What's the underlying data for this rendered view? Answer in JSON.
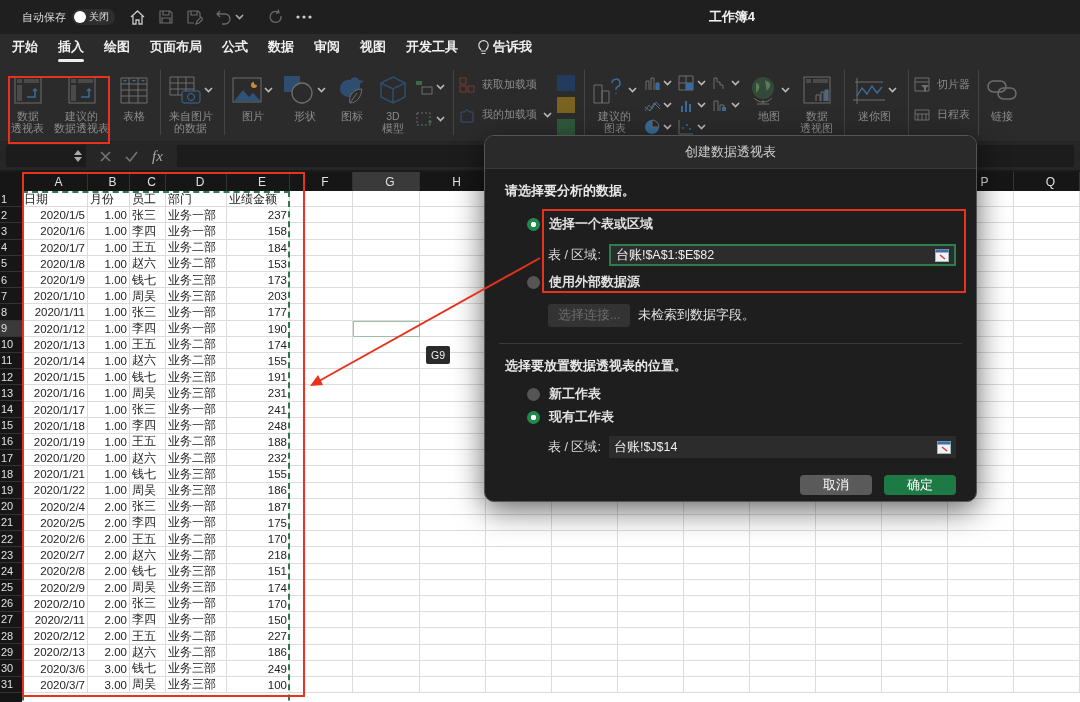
{
  "title_bar": {
    "autosave_label": "自动保存",
    "autosave_toggle": {
      "label": "关闭",
      "on": false
    },
    "title": "工作簿4"
  },
  "tabs": [
    {
      "label": "开始",
      "selected": false,
      "kind": "tab"
    },
    {
      "label": "插入",
      "selected": true,
      "kind": "tab"
    },
    {
      "label": "绘图",
      "selected": false,
      "kind": "tab"
    },
    {
      "label": "页面布局",
      "selected": false,
      "kind": "tab"
    },
    {
      "label": "公式",
      "selected": false,
      "kind": "tab"
    },
    {
      "label": "数据",
      "selected": false,
      "kind": "tab"
    },
    {
      "label": "审阅",
      "selected": false,
      "kind": "tab"
    },
    {
      "label": "视图",
      "selected": false,
      "kind": "tab"
    },
    {
      "label": "开发工具",
      "selected": false,
      "kind": "tab"
    },
    {
      "label": "告诉我",
      "selected": false,
      "kind": "tell"
    }
  ],
  "ribbon": {
    "disabled": true,
    "groups": [
      {
        "items": [
          {
            "kind": "large",
            "lines": [
              "数据",
              "透视表"
            ]
          },
          {
            "kind": "large",
            "lines": [
              "建议的",
              "数据透视表"
            ]
          },
          {
            "kind": "large",
            "lines": [
              "表格"
            ]
          }
        ]
      },
      {
        "items": [
          {
            "kind": "large",
            "lines": [
              "来自图片",
              "的数据"
            ],
            "menu": true
          }
        ]
      },
      {
        "items": [
          {
            "kind": "large",
            "lines": [
              "图片"
            ],
            "menu": true
          },
          {
            "kind": "large",
            "lines": [
              "形状"
            ],
            "menu": true
          },
          {
            "kind": "large",
            "lines": [
              "图标"
            ]
          },
          {
            "kind": "large",
            "lines": [
              "3D",
              "模型"
            ]
          },
          {
            "kind": "icons"
          }
        ]
      },
      {
        "items": [
          {
            "kind": "small_stack",
            "items": [
              {
                "label": "获取加载项",
                "menu": false
              },
              {
                "label": "我的加载项",
                "menu": true
              }
            ]
          },
          {
            "kind": "icons"
          }
        ]
      },
      {
        "items": [
          {
            "kind": "large",
            "lines": [
              "建议的",
              "图表"
            ],
            "menu": true
          },
          {
            "kind": "icons"
          },
          {
            "kind": "large",
            "lines": [
              "地图"
            ],
            "menu": true
          },
          {
            "kind": "large",
            "lines": [
              "数据",
              "透视图"
            ]
          }
        ]
      },
      {
        "items": [
          {
            "kind": "large",
            "lines": [
              "迷你图"
            ],
            "menu": true
          }
        ]
      },
      {
        "items": [
          {
            "kind": "small_stack",
            "items": [
              {
                "label": "切片器",
                "menu": false
              },
              {
                "label": "日程表",
                "menu": false
              }
            ]
          }
        ]
      },
      {
        "items": [
          {
            "kind": "large",
            "lines": [
              "链接"
            ]
          }
        ]
      }
    ]
  },
  "formula_bar": {
    "function_label": "fx"
  },
  "spreadsheet": {
    "copy_marquee": true,
    "columns": [
      {
        "label": "A",
        "selected": false
      },
      {
        "label": "B",
        "selected": false
      },
      {
        "label": "C",
        "selected": false
      },
      {
        "label": "D",
        "selected": false
      },
      {
        "label": "E",
        "selected": false
      },
      {
        "label": "F",
        "selected": false
      },
      {
        "label": "G",
        "selected": true
      },
      {
        "label": "H",
        "selected": false
      },
      {
        "label": "P",
        "selected": false
      },
      {
        "label": "Q",
        "selected": false
      }
    ],
    "rows": [
      {
        "number": "1",
        "selected": false,
        "cells": [
          "日期",
          "月份",
          "员工",
          "部门",
          "业绩金额"
        ]
      },
      {
        "number": "2",
        "selected": false,
        "cells": [
          "2020/1/5",
          "1.00",
          "张三",
          "业务一部",
          "237"
        ]
      },
      {
        "number": "3",
        "selected": false,
        "cells": [
          "2020/1/6",
          "1.00",
          "李四",
          "业务一部",
          "158"
        ]
      },
      {
        "number": "4",
        "selected": false,
        "cells": [
          "2020/1/7",
          "1.00",
          "王五",
          "业务二部",
          "184"
        ]
      },
      {
        "number": "5",
        "selected": false,
        "cells": [
          "2020/1/8",
          "1.00",
          "赵六",
          "业务二部",
          "153"
        ]
      },
      {
        "number": "6",
        "selected": false,
        "cells": [
          "2020/1/9",
          "1.00",
          "钱七",
          "业务三部",
          "173"
        ]
      },
      {
        "number": "7",
        "selected": false,
        "cells": [
          "2020/1/10",
          "1.00",
          "周吴",
          "业务三部",
          "203"
        ]
      },
      {
        "number": "8",
        "selected": false,
        "cells": [
          "2020/1/11",
          "1.00",
          "张三",
          "业务一部",
          "177"
        ]
      },
      {
        "number": "9",
        "selected": true,
        "cells": [
          "2020/1/12",
          "1.00",
          "李四",
          "业务一部",
          "190"
        ]
      },
      {
        "number": "10",
        "selected": false,
        "cells": [
          "2020/1/13",
          "1.00",
          "王五",
          "业务二部",
          "174"
        ]
      },
      {
        "number": "11",
        "selected": false,
        "cells": [
          "2020/1/14",
          "1.00",
          "赵六",
          "业务二部",
          "155"
        ]
      },
      {
        "number": "12",
        "selected": false,
        "cells": [
          "2020/1/15",
          "1.00",
          "钱七",
          "业务三部",
          "191"
        ]
      },
      {
        "number": "13",
        "selected": false,
        "cells": [
          "2020/1/16",
          "1.00",
          "周吴",
          "业务三部",
          "231"
        ]
      },
      {
        "number": "14",
        "selected": false,
        "cells": [
          "2020/1/17",
          "1.00",
          "张三",
          "业务一部",
          "241"
        ]
      },
      {
        "number": "15",
        "selected": false,
        "cells": [
          "2020/1/18",
          "1.00",
          "李四",
          "业务一部",
          "248"
        ]
      },
      {
        "number": "16",
        "selected": false,
        "cells": [
          "2020/1/19",
          "1.00",
          "王五",
          "业务二部",
          "188"
        ]
      },
      {
        "number": "17",
        "selected": false,
        "cells": [
          "2020/1/20",
          "1.00",
          "赵六",
          "业务二部",
          "232"
        ]
      },
      {
        "number": "18",
        "selected": false,
        "cells": [
          "2020/1/21",
          "1.00",
          "钱七",
          "业务三部",
          "155"
        ]
      },
      {
        "number": "19",
        "selected": false,
        "cells": [
          "2020/1/22",
          "1.00",
          "周吴",
          "业务三部",
          "186"
        ]
      },
      {
        "number": "20",
        "selected": false,
        "cells": [
          "2020/2/4",
          "2.00",
          "张三",
          "业务一部",
          "187"
        ]
      },
      {
        "number": "21",
        "selected": false,
        "cells": [
          "2020/2/5",
          "2.00",
          "李四",
          "业务一部",
          "175"
        ]
      },
      {
        "number": "22",
        "selected": false,
        "cells": [
          "2020/2/6",
          "2.00",
          "王五",
          "业务二部",
          "170"
        ]
      },
      {
        "number": "23",
        "selected": false,
        "cells": [
          "2020/2/7",
          "2.00",
          "赵六",
          "业务二部",
          "218"
        ]
      },
      {
        "number": "24",
        "selected": false,
        "cells": [
          "2020/2/8",
          "2.00",
          "钱七",
          "业务三部",
          "151"
        ]
      },
      {
        "number": "25",
        "selected": false,
        "cells": [
          "2020/2/9",
          "2.00",
          "周吴",
          "业务三部",
          "174"
        ]
      },
      {
        "number": "26",
        "selected": false,
        "cells": [
          "2020/2/10",
          "2.00",
          "张三",
          "业务一部",
          "170"
        ]
      },
      {
        "number": "27",
        "selected": false,
        "cells": [
          "2020/2/11",
          "2.00",
          "李四",
          "业务一部",
          "150"
        ]
      },
      {
        "number": "28",
        "selected": false,
        "cells": [
          "2020/2/12",
          "2.00",
          "王五",
          "业务二部",
          "227"
        ]
      },
      {
        "number": "29",
        "selected": false,
        "cells": [
          "2020/2/13",
          "2.00",
          "赵六",
          "业务二部",
          "186"
        ]
      },
      {
        "number": "30",
        "selected": false,
        "cells": [
          "2020/3/6",
          "3.00",
          "钱七",
          "业务三部",
          "249"
        ]
      },
      {
        "number": "31",
        "selected": false,
        "cells": [
          "2020/3/7",
          "3.00",
          "周吴",
          "业务三部",
          "100"
        ]
      }
    ],
    "cell_tooltip": "G9"
  },
  "dialog": {
    "title": "创建数据透视表",
    "source_heading": "请选择要分析的数据。",
    "source_options": [
      {
        "label": "选择一个表或区域",
        "selected": true
      },
      {
        "label": "使用外部数据源",
        "selected": false
      }
    ],
    "source_range_label": "表 / 区域:",
    "source_range_value": "台账!$A$1:$E$82",
    "connect_button": {
      "label": "选择连接...",
      "disabled": true
    },
    "connect_note": "未检索到数据字段。",
    "destination_heading": "选择要放置数据透视表的位置。",
    "destination_options": [
      {
        "label": "新工作表",
        "selected": false
      },
      {
        "label": "现有工作表",
        "selected": true
      }
    ],
    "destination_range_label": "表 / 区域:",
    "destination_range_value": "台账!$J$14",
    "buttons": [
      {
        "label": "取消",
        "kind": "cancel"
      },
      {
        "label": "确定",
        "kind": "default"
      }
    ]
  },
  "annotations": [
    {
      "kind": "box"
    },
    {
      "kind": "box"
    },
    {
      "kind": "box"
    },
    {
      "kind": "arrow"
    }
  ]
}
